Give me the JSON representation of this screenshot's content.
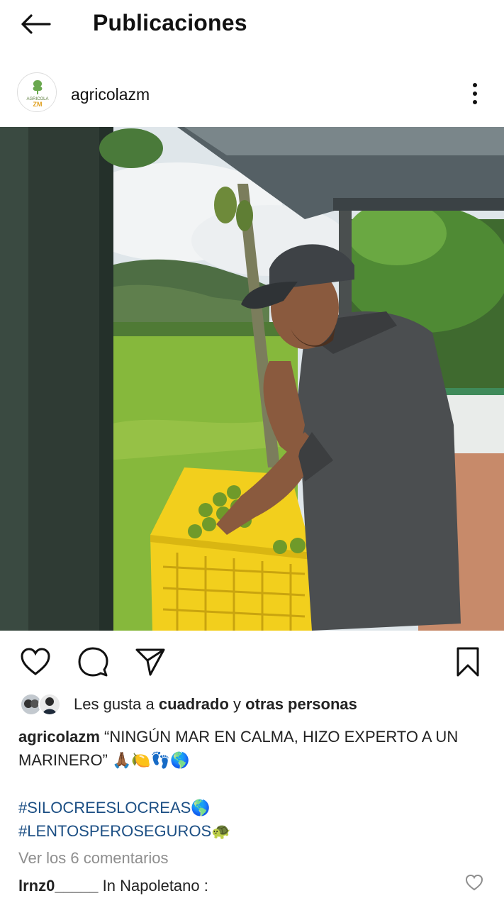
{
  "header": {
    "title": "Publicaciones",
    "back_icon": "arrow-left-icon"
  },
  "post": {
    "username": "agricolazm",
    "avatar_text_top": "AGRICOLA",
    "avatar_text_mid": "ZM",
    "more_icon": "more-vertical-icon"
  },
  "actions": {
    "like_icon": "heart-icon",
    "comment_icon": "comment-icon",
    "share_icon": "send-icon",
    "save_icon": "bookmark-icon"
  },
  "likes": {
    "prefix": "Les gusta a ",
    "user": "cuadrado",
    "connector": " y ",
    "others": "otras personas"
  },
  "caption": {
    "user": "agricolazm",
    "text": " “NINGÚN MAR EN CALMA, HIZO EXPERTO A UN MARINERO” 🙏🏾🍋👣🌎"
  },
  "hashtags": [
    "#SILOCREESLOCREAS🌎",
    "#LENTOSPEROSEGUROS🐢"
  ],
  "comments": {
    "view_all": "Ver los 6 comentarios",
    "first_user": "lrnz0_____",
    "first_text": " In Napoletano :"
  },
  "colors": {
    "hashtag": "#1c4f84",
    "muted": "#8e8e8e",
    "crate": "#f2cf1d"
  }
}
